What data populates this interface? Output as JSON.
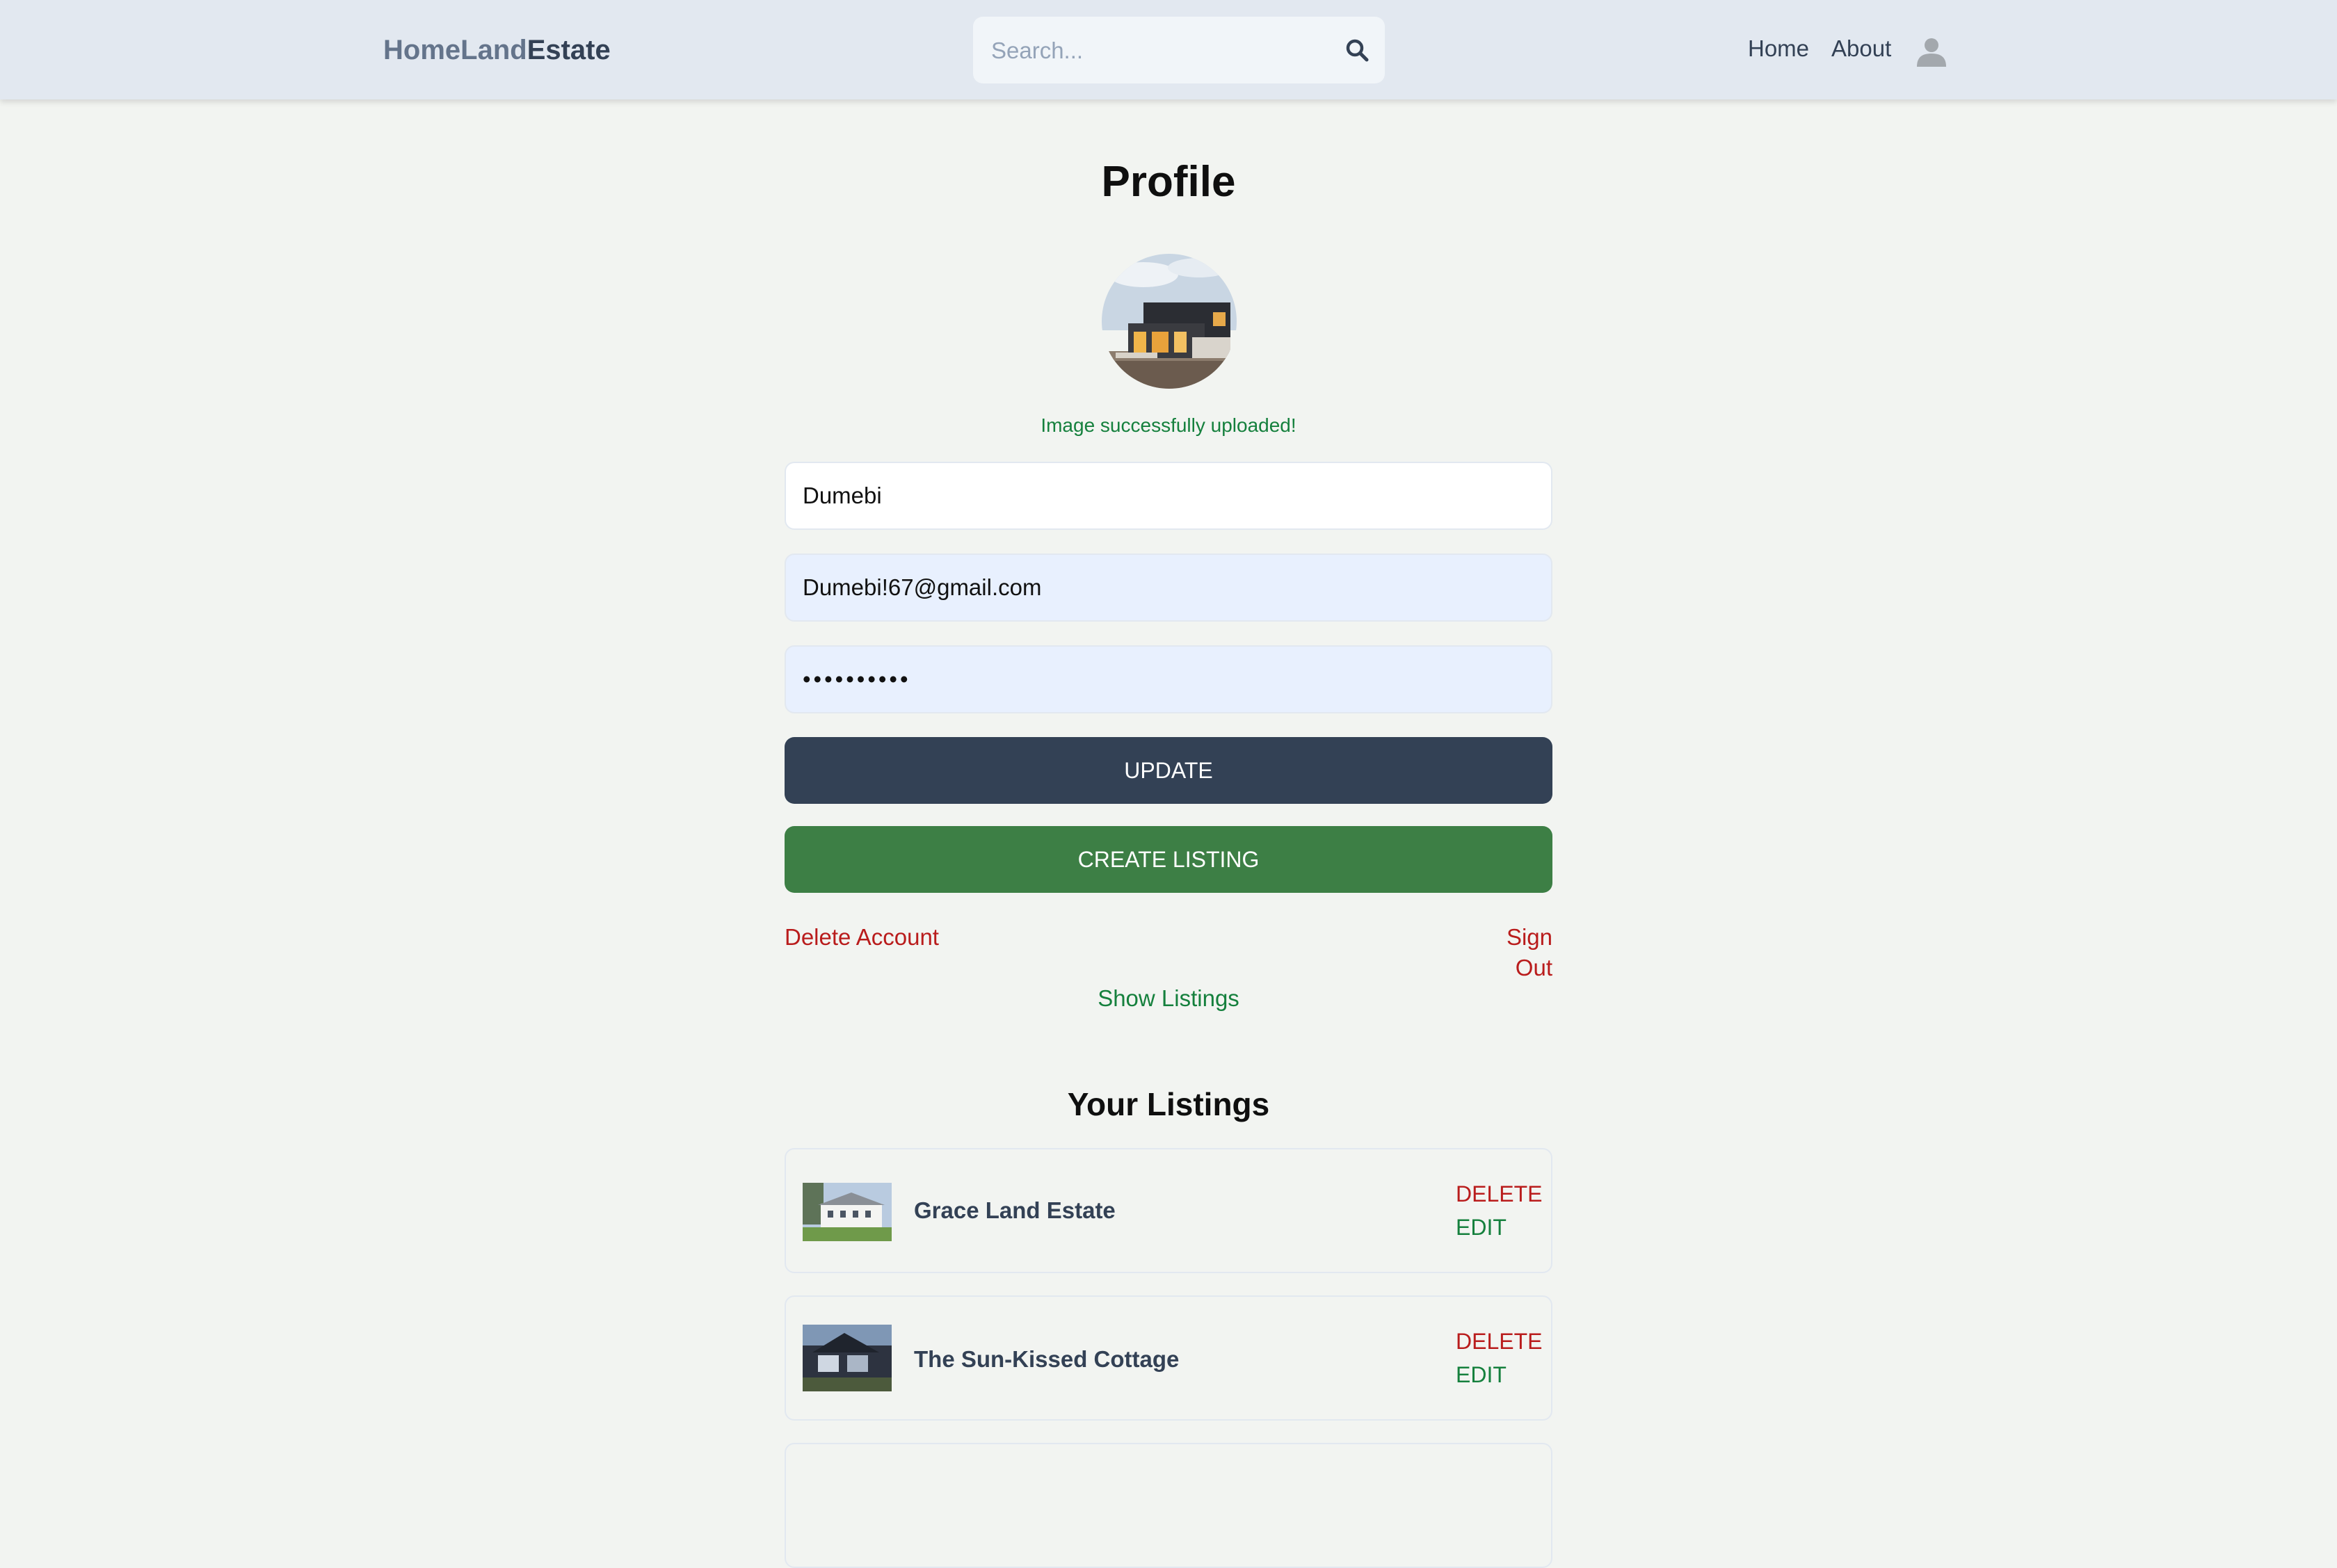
{
  "header": {
    "logo_part1": "HomeLand",
    "logo_part2": "Estate",
    "search_placeholder": "Search...",
    "search_icon": "search-icon",
    "nav": {
      "home": "Home",
      "about": "About"
    },
    "avatar_icon": "user-avatar-icon"
  },
  "profile": {
    "title": "Profile",
    "upload_message": "Image successfully uploaded!",
    "username": "Dumebi",
    "email": "Dumebi!67@gmail.com",
    "password": "••••••••••",
    "update_label": "UPDATE",
    "create_listing_label": "CREATE LISTING",
    "delete_account_label": "Delete Account",
    "sign_out_label": "Sign Out",
    "show_listings_label": "Show Listings"
  },
  "listings": {
    "title": "Your Listings",
    "items": [
      {
        "name": "Grace Land Estate",
        "delete_label": "DELETE",
        "edit_label": "EDIT"
      },
      {
        "name": "The Sun-Kissed Cottage",
        "delete_label": "DELETE",
        "edit_label": "EDIT"
      }
    ]
  },
  "colors": {
    "header_bg": "#e2e8f0",
    "page_bg": "#f2f4f1",
    "update_button": "#334155",
    "create_button": "#3d7f45",
    "danger": "#b91c1c",
    "success": "#15803d"
  }
}
